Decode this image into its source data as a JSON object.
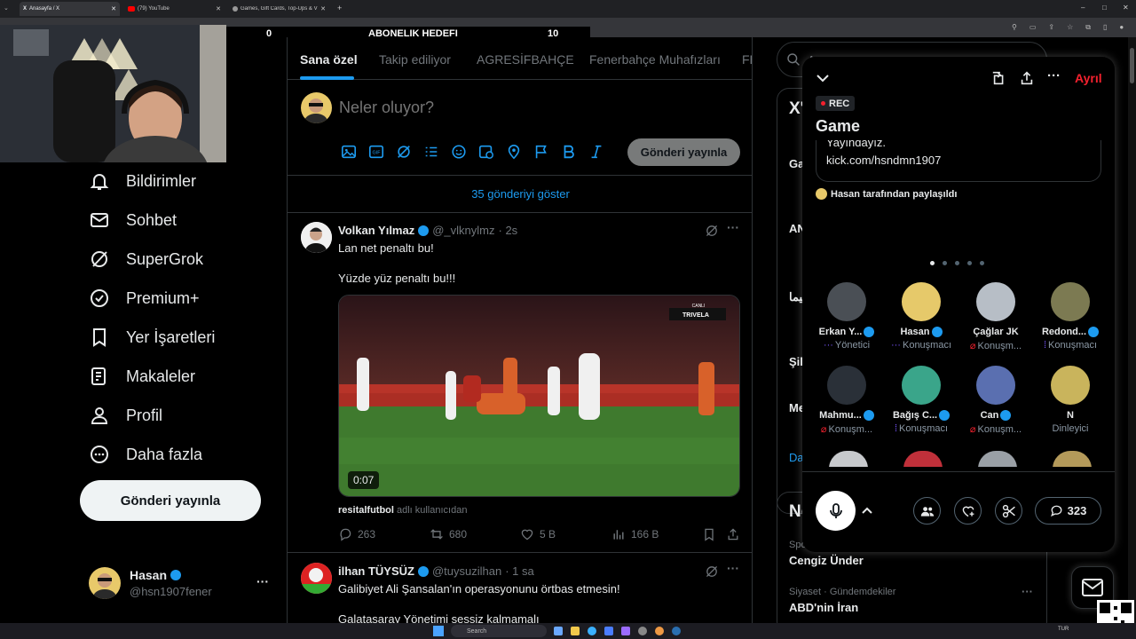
{
  "browser": {
    "tabs": [
      {
        "label": "Anasayfa / X",
        "active": true
      },
      {
        "label": "(79) YouTube",
        "active": false
      },
      {
        "label": "Games, Gift Cards, Top-Ups & V",
        "active": false
      }
    ],
    "new_tab": "+"
  },
  "stream_overlay": {
    "left_count": "0",
    "title": "ABONELIK HEDEFI",
    "right_count": "10"
  },
  "nav": {
    "items": [
      {
        "label": "Bildirimler",
        "icon": "bell-icon"
      },
      {
        "label": "Sohbet",
        "icon": "mail-icon"
      },
      {
        "label": "SuperGrok",
        "icon": "grok-icon"
      },
      {
        "label": "Premium+",
        "icon": "verified-badge-icon"
      },
      {
        "label": "Yer İşaretleri",
        "icon": "bookmark-icon"
      },
      {
        "label": "Makaleler",
        "icon": "article-icon"
      },
      {
        "label": "Profil",
        "icon": "person-icon"
      },
      {
        "label": "Daha fazla",
        "icon": "more-circle-icon"
      }
    ],
    "post_button": "Gönderi yayınla",
    "account": {
      "name": "Hasan",
      "handle": "@hsn1907fener",
      "more": "···"
    }
  },
  "feed": {
    "tabs": [
      "Sana özel",
      "Takip ediliyor",
      "AGRESİFBAHÇE",
      "Fenerbahçe Muhafızları",
      "FE"
    ],
    "composer": {
      "placeholder": "Neler oluyor?",
      "post_button": "Gönderi yayınla"
    },
    "show_more": "35 gönderiyi göster",
    "tweets": [
      {
        "name": "Volkan Yılmaz",
        "handle": "@_vlknylmz",
        "time": "· 2s",
        "lines": [
          "Lan net penaltı bu!",
          "Yüzde yüz penaltı bu!!!"
        ],
        "video_duration": "0:07",
        "video_badge": "TRIVELA",
        "video_live": "CANLI",
        "source_user": "resitalfutbol",
        "source_suffix": "adlı kullanıcıdan",
        "replies": "263",
        "reposts": "680",
        "likes": "5 B",
        "views": "166 B"
      },
      {
        "name": "ilhan TÜYSÜZ",
        "handle": "@tuysuzilhan",
        "time": "· 1 sa",
        "lines": [
          "Galibiyet Ali Şansalan'ın operasyonunu örtbas etmesin!",
          "Galatasaray Yönetimi sessiz kalmamalı"
        ]
      }
    ]
  },
  "right": {
    "search_placeholder": "A",
    "box1_title": "X'",
    "box1_items": [
      "Ga",
      "AN",
      "ليما",
      "Şil",
      "Me"
    ],
    "box1_more": "Da",
    "box2_title": "Ne",
    "trends": [
      {
        "category": "Spo",
        "title": "Cengiz Ünder"
      },
      {
        "category": "Siyaset · Gündemdekiler",
        "title": "ABD'nin İran",
        "more": "···"
      }
    ]
  },
  "space": {
    "leave": "Ayrıl",
    "rec": "REC",
    "title": "Game",
    "pinned_line1": "Yayındayız.",
    "pinned_line2": "kick.com/hsndmn1907",
    "shared_by": "Hasan tarafından paylaşıldı",
    "participants": [
      {
        "name": "Erkan Y...",
        "role": "Yönetici",
        "verified": true,
        "color": "#4a4f55"
      },
      {
        "name": "Hasan",
        "role": "Konuşmacı",
        "verified": true,
        "color": "#e6c96a"
      },
      {
        "name": "Çağlar JK",
        "role": "Konuşm...",
        "verified": false,
        "color": "#b7bec6"
      },
      {
        "name": "Redond...",
        "role": "Konuşmacı",
        "verified": true,
        "color": "#7c7a52"
      },
      {
        "name": "Mahmu...",
        "role": "Konuşm...",
        "verified": true,
        "color": "#2a3038"
      },
      {
        "name": "Bağış C...",
        "role": "Konuşmacı",
        "verified": true,
        "color": "#3aa58a"
      },
      {
        "name": "Can",
        "role": "Konuşm...",
        "verified": true,
        "color": "#5a6fb0"
      },
      {
        "name": "N",
        "role": "Dinleyici",
        "verified": false,
        "color": "#c9b45c"
      }
    ],
    "comment_count": "323",
    "colors": {
      "leave": "#f4212e",
      "rec_dot": "#f4212e",
      "verified": "#1d9bf0",
      "speaking": "#7856ff"
    }
  },
  "taskbar": {
    "search": "Search",
    "lang": "TUR"
  }
}
